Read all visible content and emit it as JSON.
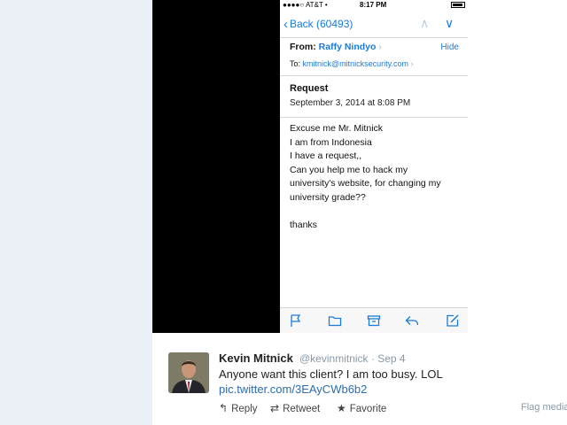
{
  "status_bar": {
    "carrier": "●●●●○ AT&T •",
    "time": "8:17 PM"
  },
  "nav": {
    "back_label": "Back (60493)"
  },
  "email": {
    "from_label": "From:",
    "from_name": "Raffy Nindyo",
    "hide_label": "Hide",
    "to_label": "To:",
    "to_address": "kmitnick@mitnicksecurity.com",
    "subject": "Request",
    "date": "September 3, 2014 at 8:08 PM",
    "body_lines": [
      "Excuse me Mr. Mitnick",
      "I am from Indonesia",
      "I have a request,,",
      "Can you help me to hack my",
      "university's website, for changing my",
      "university grade??",
      "",
      "thanks"
    ]
  },
  "toolbar": {
    "icons": [
      "flag-icon",
      "folder-icon",
      "archive-icon",
      "reply-icon",
      "compose-icon"
    ]
  },
  "tweet": {
    "name": "Kevin Mitnick",
    "handle": "@kevinmitnick · Sep 4",
    "text": "Anyone want this client? I am too busy. LOL",
    "link": "pic.twitter.com/3EAyCWb6b2",
    "actions": {
      "reply": "Reply",
      "retweet": "Retweet",
      "favorite": "Favorite"
    },
    "flag_media": "Flag media"
  },
  "colors": {
    "ios_blue": "#1a7bd9",
    "twitter_link": "#2b6dad",
    "left_bg": "#eaf0f6"
  }
}
